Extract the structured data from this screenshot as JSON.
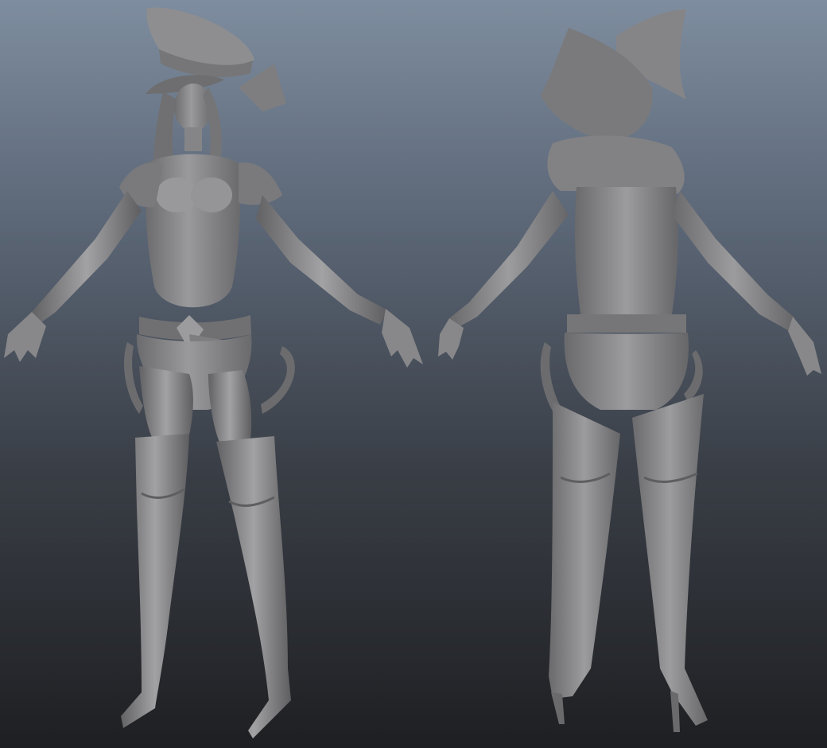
{
  "viewport": {
    "background_top": "#7e8d9f",
    "background_mid": "#5b6676",
    "background_bottom": "#1e1f22",
    "model_color": "#8c8c8e",
    "model_shadow": "#5c5c5e",
    "model_highlight": "#b4b4b6"
  },
  "models": [
    {
      "view": "front",
      "description_icon": "sculpt-front-view"
    },
    {
      "view": "back",
      "description_icon": "sculpt-back-view"
    }
  ]
}
